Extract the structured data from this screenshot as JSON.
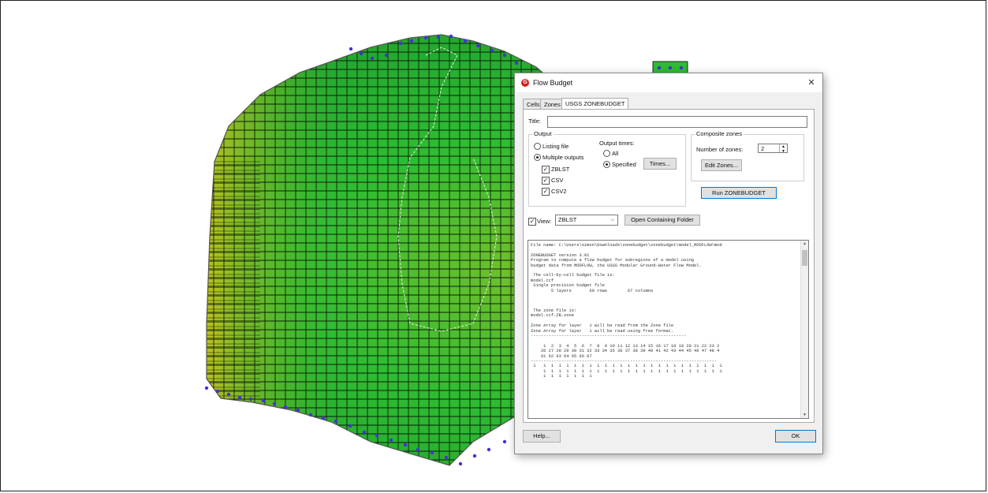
{
  "dialog": {
    "title": "Flow Budget",
    "close_glyph": "✕",
    "app_icon_glyph": "G",
    "tabs": [
      {
        "label": "Cells",
        "active": false
      },
      {
        "label": "Zones",
        "active": false
      },
      {
        "label": "USGS ZONEBUDGET",
        "active": true
      }
    ],
    "title_field": {
      "label": "Title:",
      "value": ""
    },
    "output_group": {
      "label": "Output",
      "listing_file": {
        "label": "Listing file",
        "selected": false
      },
      "multiple_outputs": {
        "label": "Multiple outputs",
        "selected": true
      },
      "checks": [
        {
          "label": "ZBLST",
          "checked": true
        },
        {
          "label": "CSV",
          "checked": true
        },
        {
          "label": "CSV2",
          "checked": true
        }
      ]
    },
    "output_times": {
      "label": "Output times:",
      "all": {
        "label": "All",
        "selected": false
      },
      "specified": {
        "label": "Specified",
        "selected": true
      },
      "times_button": "Times..."
    },
    "composite_zones": {
      "label": "Composite zones",
      "number_label": "Number of zones:",
      "number_value": "2",
      "edit_button": "Edit Zones..."
    },
    "run_button": "Run ZONEBUDGET",
    "view": {
      "label": "View:",
      "checked": true,
      "selected": "ZBLST",
      "open_folder_button": "Open Containing Folder"
    },
    "output_lines": [
      "File name: C:\\Users\\simon\\Downloads\\zonebudget\\zonebudget\\model_MODFLOW\\mod",
      "",
      "ZONEBUDGET version 3.01",
      "Program to compute a flow budget for subregions of a model using",
      "budget data from MODFLOW, the USGS Modular Ground-Water Flow Model.",
      "",
      " The cell-by-cell budget file is:",
      "model.ccf",
      " Single precision budget file",
      "        5 layers       60 rows        67 columns",
      "",
      "",
      "",
      " The zone file is:",
      "model.ccf.ZB.zone",
      "",
      "Zone Array for layer   1 will be read from the Zone file",
      "Zone Array for layer   1 will be read using free format.",
      "-------------------------------------------------------------",
      "",
      "     1  2  3  4  5  6  7  8  9 10 11 12 13 14 15 16 17 18 19 20 21 22 23 2",
      "    26 27 28 29 30 31 32 33 34 35 36 37 38 39 40 41 42 43 44 45 46 47 48 4",
      "    61 62 63 64 65 66 67",
      "-------------------------------------------------------------------------",
      " 1   1  1  1  1  1  1  1  1  1  1  1  1  1  1  1  1  1  1  1  1  1  1  1  1",
      "     1  1  1  1  1  1  1  1  1  1  1  1  1  1  1  1  1  1  1  1  1  1  1  1",
      "     1  1  1  1  1  1  1"
    ],
    "help_button": "Help...",
    "ok_button": "OK"
  },
  "colors": {
    "cell_stroke": "#0b1f08",
    "boundary_marker": "#4a2fd9",
    "dialog_bg": "#f0f0f0",
    "accent_blue": "#0078d7"
  }
}
